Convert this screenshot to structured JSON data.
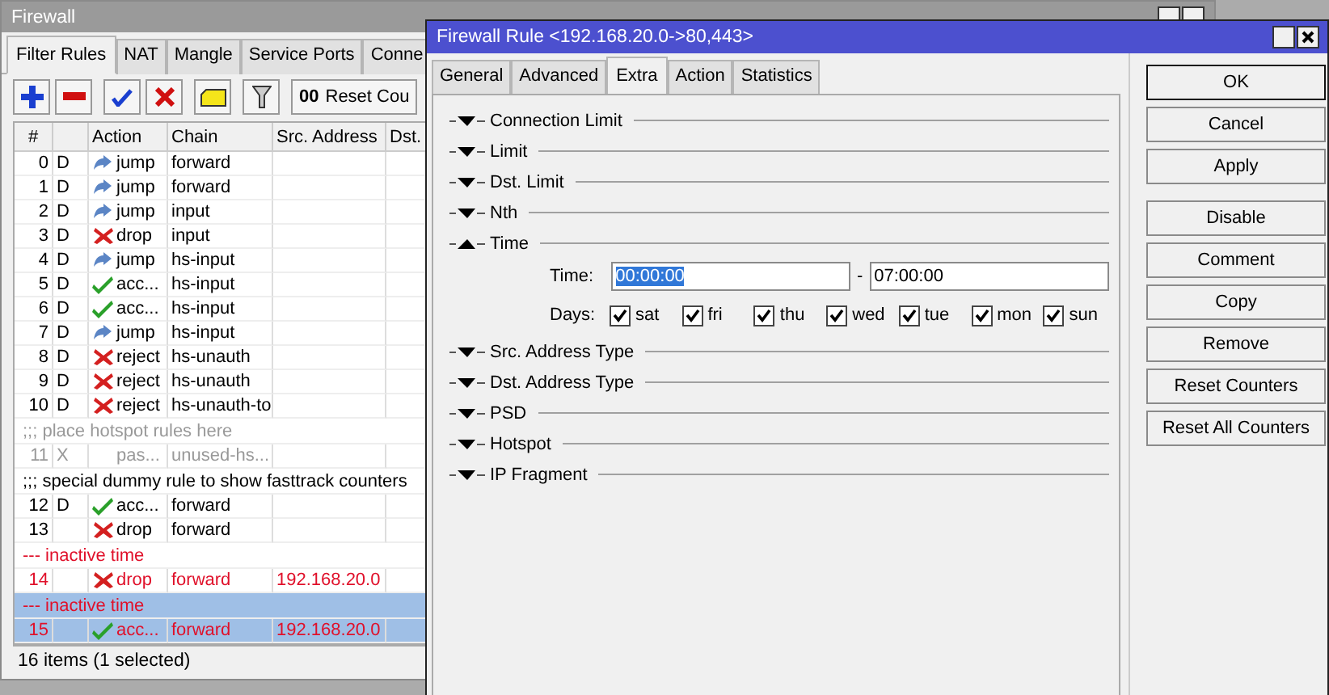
{
  "main_window": {
    "title": "Firewall",
    "tabs": [
      {
        "label": "Filter Rules",
        "selected": true
      },
      {
        "label": "NAT",
        "selected": false
      },
      {
        "label": "Mangle",
        "selected": false
      },
      {
        "label": "Service Ports",
        "selected": false
      },
      {
        "label": "Conne",
        "selected": false
      }
    ],
    "toolbar": {
      "reset_icon": "00",
      "reset_button": "Reset Cou"
    },
    "table": {
      "columns": [
        "#",
        "",
        "Action",
        "Chain",
        "Src. Address",
        "Dst."
      ],
      "rows": [
        {
          "kind": "jump",
          "num": "0",
          "flag": "D",
          "action": "jump",
          "chain": "forward",
          "src": "",
          "disabled": false,
          "inactive": false,
          "selected": false
        },
        {
          "kind": "jump",
          "num": "1",
          "flag": "D",
          "action": "jump",
          "chain": "forward",
          "src": "",
          "disabled": false,
          "inactive": false,
          "selected": false
        },
        {
          "kind": "jump",
          "num": "2",
          "flag": "D",
          "action": "jump",
          "chain": "input",
          "src": "",
          "disabled": false,
          "inactive": false,
          "selected": false
        },
        {
          "kind": "drop",
          "num": "3",
          "flag": "D",
          "action": "drop",
          "chain": "input",
          "src": "",
          "disabled": false,
          "inactive": false,
          "selected": false
        },
        {
          "kind": "jump",
          "num": "4",
          "flag": "D",
          "action": "jump",
          "chain": "hs-input",
          "src": "",
          "disabled": false,
          "inactive": false,
          "selected": false
        },
        {
          "kind": "accept",
          "num": "5",
          "flag": "D",
          "action": "acc...",
          "chain": "hs-input",
          "src": "",
          "disabled": false,
          "inactive": false,
          "selected": false
        },
        {
          "kind": "accept",
          "num": "6",
          "flag": "D",
          "action": "acc...",
          "chain": "hs-input",
          "src": "",
          "disabled": false,
          "inactive": false,
          "selected": false
        },
        {
          "kind": "jump",
          "num": "7",
          "flag": "D",
          "action": "jump",
          "chain": "hs-input",
          "src": "",
          "disabled": false,
          "inactive": false,
          "selected": false
        },
        {
          "kind": "reject",
          "num": "8",
          "flag": "D",
          "action": "reject",
          "chain": "hs-unauth",
          "src": "",
          "disabled": false,
          "inactive": false,
          "selected": false
        },
        {
          "kind": "reject",
          "num": "9",
          "flag": "D",
          "action": "reject",
          "chain": "hs-unauth",
          "src": "",
          "disabled": false,
          "inactive": false,
          "selected": false
        },
        {
          "kind": "reject",
          "num": "10",
          "flag": "D",
          "action": "reject",
          "chain": "hs-unauth-to",
          "src": "",
          "disabled": false,
          "inactive": false,
          "selected": false
        },
        {
          "kind": "comment",
          "text": ";;; place hotspot rules here",
          "disabled": true,
          "inactive": false,
          "selected": false
        },
        {
          "kind": "passthrough",
          "num": "11",
          "flag": "X",
          "action": "pas...",
          "chain": "unused-hs...",
          "src": "",
          "disabled": true,
          "inactive": false,
          "selected": false
        },
        {
          "kind": "comment",
          "text": ";;; special dummy rule to show fasttrack counters",
          "disabled": false,
          "inactive": false,
          "selected": false
        },
        {
          "kind": "accept",
          "num": "12",
          "flag": "D",
          "action": "acc...",
          "chain": "forward",
          "src": "",
          "disabled": false,
          "inactive": false,
          "selected": false
        },
        {
          "kind": "drop",
          "num": "13",
          "flag": "",
          "action": "drop",
          "chain": "forward",
          "src": "",
          "disabled": false,
          "inactive": false,
          "selected": false
        },
        {
          "kind": "comment",
          "text": "--- inactive time",
          "disabled": false,
          "inactive": true,
          "selected": false
        },
        {
          "kind": "drop",
          "num": "14",
          "flag": "",
          "action": "drop",
          "chain": "forward",
          "src": "192.168.20.0",
          "disabled": false,
          "inactive": true,
          "selected": false
        },
        {
          "kind": "comment",
          "text": "--- inactive time",
          "disabled": false,
          "inactive": true,
          "selected": true
        },
        {
          "kind": "accept",
          "num": "15",
          "flag": "",
          "action": "acc...",
          "chain": "forward",
          "src": "192.168.20.0",
          "disabled": false,
          "inactive": true,
          "selected": true
        }
      ]
    },
    "status_bar": "16 items (1 selected)"
  },
  "dialog": {
    "title": "Firewall Rule <192.168.20.0->80,443>",
    "tabs": [
      {
        "label": "General",
        "selected": false
      },
      {
        "label": "Advanced",
        "selected": false
      },
      {
        "label": "Extra",
        "selected": true
      },
      {
        "label": "Action",
        "selected": false
      },
      {
        "label": "Statistics",
        "selected": false
      }
    ],
    "sections": [
      {
        "label": "Connection Limit",
        "expanded": false
      },
      {
        "label": "Limit",
        "expanded": false
      },
      {
        "label": "Dst. Limit",
        "expanded": false
      },
      {
        "label": "Nth",
        "expanded": false
      },
      {
        "label": "Time",
        "expanded": true,
        "time_label": "Time:",
        "time_from": "00:00:00",
        "separator": "-",
        "time_to": "07:00:00",
        "days_label": "Days:",
        "days": [
          {
            "label": "sat",
            "checked": true
          },
          {
            "label": "fri",
            "checked": true
          },
          {
            "label": "thu",
            "checked": true
          },
          {
            "label": "wed",
            "checked": true
          },
          {
            "label": "tue",
            "checked": true
          },
          {
            "label": "mon",
            "checked": true
          },
          {
            "label": "sun",
            "checked": true
          }
        ]
      },
      {
        "label": "Src. Address Type",
        "expanded": false
      },
      {
        "label": "Dst. Address Type",
        "expanded": false
      },
      {
        "label": "PSD",
        "expanded": false
      },
      {
        "label": "Hotspot",
        "expanded": false
      },
      {
        "label": "IP Fragment",
        "expanded": false
      }
    ],
    "buttons": [
      {
        "label": "OK",
        "default": true
      },
      {
        "label": "Cancel",
        "default": false
      },
      {
        "label": "Apply",
        "default": false
      },
      {
        "label": "Disable",
        "default": false
      },
      {
        "label": "Comment",
        "default": false
      },
      {
        "label": "Copy",
        "default": false
      },
      {
        "label": "Remove",
        "default": false
      },
      {
        "label": "Reset Counters",
        "default": false
      },
      {
        "label": "Reset All Counters",
        "default": false
      }
    ]
  }
}
